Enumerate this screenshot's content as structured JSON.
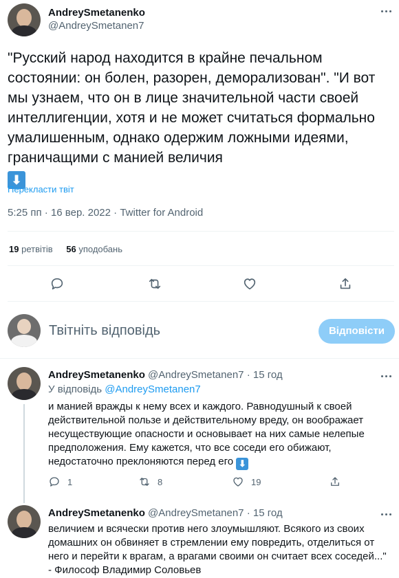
{
  "tweet": {
    "author_name": "AndreySmetanenko",
    "author_handle": "@AndreySmetanen7",
    "text": "\"Русский народ находится в крайне печальном состоянии: он болен, разорен, деморализован\". \"И вот мы узнаем, что он в лице значительной части своей интеллигенции, хотя и не может считаться формально умалишенным, однако одержим ложными идеями, граничащими с манией величия",
    "emoji_icon": "arrow-down-emoji-icon",
    "emoji_glyph": "⬇",
    "translate_label": "Перекласти твіт",
    "time": "5:25 пп",
    "sep1": "·",
    "date": "16 вер. 2022",
    "sep2": "·",
    "source": "Twitter for Android",
    "retweets_count": "19",
    "retweets_label": "ретвітів",
    "likes_count": "56",
    "likes_label": "уподобань"
  },
  "actions": {
    "reply_icon": "reply-icon",
    "retweet_icon": "retweet-icon",
    "like_icon": "heart-icon",
    "share_icon": "share-icon"
  },
  "compose": {
    "placeholder": "Твітніть відповідь",
    "button_label": "Відповісти"
  },
  "replies": [
    {
      "author_name": "AndreySmetanenko",
      "author_handle": "@AndreySmetanen7",
      "sep": "·",
      "time": "15 год",
      "replying_prefix": "У відповідь",
      "replying_to": "@AndreySmetanen7",
      "text": "и манией вражды к нему всех и каждого. Равнодушный к своей действительной пользе и действительному вреду, он воображает несуществующие опасности и основывает на них самые нелепые предположения. Ему кажется, что все соседи его обижают, недостаточно преклоняются перед его",
      "emoji_glyph": "⬇",
      "reply_count": "1",
      "retweet_count": "8",
      "like_count": "19"
    },
    {
      "author_name": "AndreySmetanenko",
      "author_handle": "@AndreySmetanen7",
      "sep": "·",
      "time": "15 год",
      "text": "величием и всячески против него злоумышляют. Всякого из своих домашних он обвиняет в стремлении ему повредить, отделиться от него и перейти к врагам, а врагами своими он считает всех соседей...\" - Философ Владимир Соловьев"
    }
  ],
  "colors": {
    "accent": "#1d9bf0",
    "muted": "#536471",
    "button_disabled": "#8ecdf8"
  }
}
